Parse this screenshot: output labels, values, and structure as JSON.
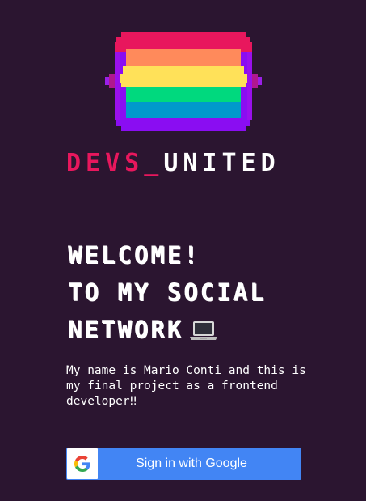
{
  "brand": {
    "name_part1": "DEVS_",
    "name_part2": "UNITED"
  },
  "headline": {
    "line1": "WELCOME!",
    "line2": "TO MY SOCIAL",
    "line3": "NETWORK"
  },
  "intro": {
    "text": "My name is Mario Conti and this is my final project as a frontend developer‼"
  },
  "signin": {
    "label": "Sign in with Google"
  },
  "colors": {
    "background": "#2b1530",
    "brand_pink": "#e8175d",
    "google_blue": "#4285f4",
    "rainbow": [
      "#f5115c",
      "#ff8a5b",
      "#ffe159",
      "#00d97e",
      "#0099cc",
      "#8a0df2"
    ]
  },
  "icons": {
    "logo": "pixel-rainbow-logo-icon",
    "laptop": "laptop-icon",
    "google": "google-g-icon"
  }
}
